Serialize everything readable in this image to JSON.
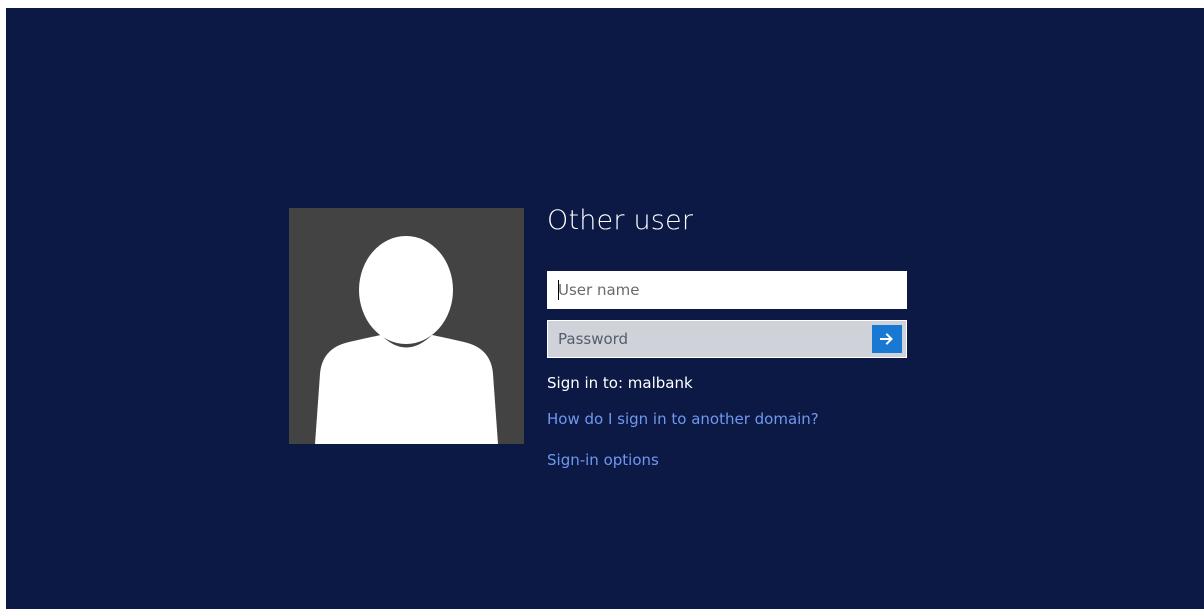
{
  "login": {
    "title": "Other user",
    "username": {
      "value": "",
      "placeholder": "User name"
    },
    "password": {
      "value": "",
      "placeholder": "Password"
    },
    "submit_icon": "arrow-right-icon",
    "sign_in_to": "Sign in to: malbank",
    "domain_help_link": "How do I sign in to another domain?",
    "signin_options_link": "Sign-in options",
    "avatar_icon": "user-silhouette-icon"
  },
  "colors": {
    "background": "#0b1944",
    "avatar_tile": "#434343",
    "link": "#6f98f0",
    "submit_accent": "#1878d2",
    "password_field": "#cfd2d9"
  }
}
